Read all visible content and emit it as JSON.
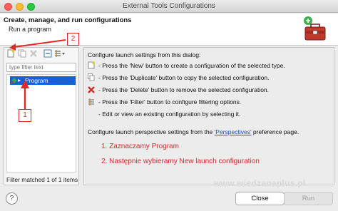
{
  "window": {
    "title": "External Tools Configurations"
  },
  "header": {
    "title": "Create, manage, and run configurations",
    "subtitle": "Run a program",
    "icon": "toolbox-icon"
  },
  "left_panel": {
    "toolbar": [
      {
        "name": "new-configuration-icon"
      },
      {
        "name": "duplicate-configuration-icon"
      },
      {
        "name": "delete-configuration-icon"
      },
      {
        "name": "collapse-all-icon"
      },
      {
        "name": "filter-configurations-icon"
      }
    ],
    "filter_placeholder": "type filter text",
    "tree": [
      {
        "label": "Program",
        "selected": true
      }
    ],
    "status": "Filter matched 1 of 1 items"
  },
  "right_panel": {
    "intro": "Configure launch settings from this dialog:",
    "items": [
      {
        "icon": "new-icon",
        "text": "- Press the 'New' button to create a configuration of the selected type."
      },
      {
        "icon": "duplicate-icon",
        "text": "- Press the 'Duplicate' button to copy the selected configuration."
      },
      {
        "icon": "delete-icon",
        "text": "- Press the 'Delete' button to remove the selected configuration."
      },
      {
        "icon": "filter-icon",
        "text": "- Press the 'Filter' button to configure filtering options."
      },
      {
        "icon": "",
        "text": "- Edit or view an existing configuration by selecting it."
      }
    ],
    "perspective_prefix": "Configure launch perspective settings from the ",
    "perspective_link": "'Perspectives'",
    "perspective_suffix": " preference page.",
    "notes": [
      "1. Zaznaczamy Program",
      "2. Następnie wybieramy New launch configuration"
    ]
  },
  "annotations": {
    "callout_1": "1",
    "callout_2": "2",
    "color": "#e02828"
  },
  "footer": {
    "help": "?",
    "watermark": "www.wiedzanaplus.pl",
    "close_label": "Close",
    "run_label": "Run"
  },
  "colors": {
    "selection": "#1560d4",
    "link": "#1a4fd0",
    "note": "#e02828"
  }
}
